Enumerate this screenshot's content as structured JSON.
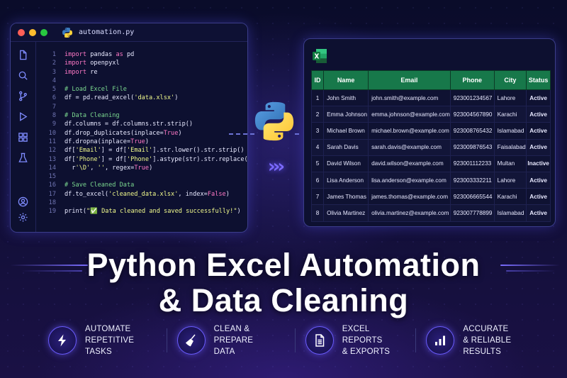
{
  "code_window": {
    "filename": "automation.py",
    "lines": [
      {
        "n": "1",
        "code": "import pandas as pd"
      },
      {
        "n": "2",
        "code": "import openpyxl"
      },
      {
        "n": "3",
        "code": "import re"
      },
      {
        "n": "4",
        "code": ""
      },
      {
        "n": "5",
        "code": "# Load Excel File"
      },
      {
        "n": "6",
        "code": "df = pd.read_excel('data.xlsx')"
      },
      {
        "n": "7",
        "code": ""
      },
      {
        "n": "8",
        "code": "# Data Cleaning"
      },
      {
        "n": "9",
        "code": "df.columns = df.columns.str.strip()"
      },
      {
        "n": "10",
        "code": "df.drop_duplicates(inplace=True)"
      },
      {
        "n": "11",
        "code": "df.dropna(inplace=True)"
      },
      {
        "n": "12",
        "code": "df['Email'] = df['Email'].str.lower().str.strip()"
      },
      {
        "n": "13",
        "code": "df['Phone'] = df['Phone'].astype(str).str.replace("
      },
      {
        "n": "14",
        "code": "  r'\\D', '', regex=True)"
      },
      {
        "n": "15",
        "code": ""
      },
      {
        "n": "16",
        "code": "# Save Cleaned Data"
      },
      {
        "n": "17",
        "code": "df.to_excel('cleaned_data.xlsx', index=False)"
      },
      {
        "n": "18",
        "code": ""
      },
      {
        "n": "19",
        "code": "print(\"✅ Data cleaned and saved successfully!\")"
      }
    ]
  },
  "sidebar_icons": [
    "file-icon",
    "search-icon",
    "git-branch-icon",
    "run-icon",
    "extensions-icon",
    "beaker-icon",
    "account-icon",
    "settings-icon"
  ],
  "excel": {
    "columns": [
      "ID",
      "Name",
      "Email",
      "Phone",
      "City",
      "Status"
    ],
    "rows": [
      [
        "1",
        "John Smith",
        "john.smith@example.com",
        "923001234567",
        "Lahore",
        "Active"
      ],
      [
        "2",
        "Emma Johnson",
        "emma.johnson@example.com",
        "923004567890",
        "Karachi",
        "Active"
      ],
      [
        "3",
        "Michael Brown",
        "michael.brown@example.com",
        "923008765432",
        "Islamabad",
        "Active"
      ],
      [
        "4",
        "Sarah Davis",
        "sarah.davis@example.com",
        "923009876543",
        "Faisalabad",
        "Active"
      ],
      [
        "5",
        "David Wilson",
        "david.wilson@example.com",
        "923001112233",
        "Multan",
        "Inactive"
      ],
      [
        "6",
        "Lisa Anderson",
        "lisa.anderson@example.com",
        "923003332211",
        "Lahore",
        "Active"
      ],
      [
        "7",
        "James Thomas",
        "james.thomas@example.com",
        "923006665544",
        "Karachi",
        "Active"
      ],
      [
        "8",
        "Olivia Martinez",
        "olivia.martinez@example.com",
        "923007778899",
        "Islamabad",
        "Active"
      ]
    ]
  },
  "headline": {
    "line1": "Python Excel Automation",
    "line2": "& Data Cleaning"
  },
  "features": [
    {
      "icon": "lightning-icon",
      "line1": "AUTOMATE",
      "line2": "REPETITIVE TASKS"
    },
    {
      "icon": "broom-icon",
      "line1": "CLEAN & PREPARE",
      "line2": "DATA"
    },
    {
      "icon": "document-icon",
      "line1": "EXCEL REPORTS",
      "line2": "& EXPORTS"
    },
    {
      "icon": "bar-chart-icon",
      "line1": "ACCURATE",
      "line2": "& RELIABLE RESULTS"
    }
  ],
  "colors": {
    "accent": "#6b5cff",
    "excel_green": "#17784a",
    "status_active": "#35e06c",
    "status_inactive": "#ff4d5e"
  }
}
